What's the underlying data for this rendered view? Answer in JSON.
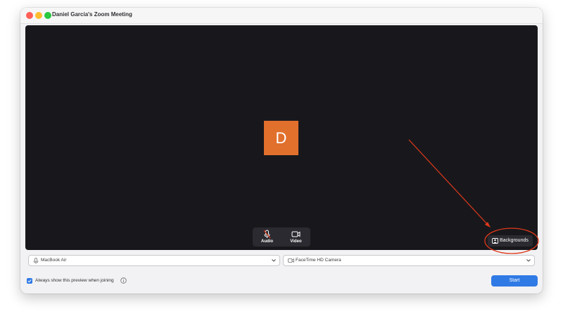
{
  "window": {
    "title": "Daniel Garcia's Zoom Meeting"
  },
  "preview": {
    "avatar_initial": "D",
    "avatar_color": "#e1702d"
  },
  "controls": {
    "audio_label": "Audio",
    "video_label": "Video"
  },
  "backgrounds": {
    "label": "Backgrounds"
  },
  "devices": {
    "microphone": "MacBook Air",
    "camera": "FaceTime HD Camera"
  },
  "footer": {
    "always_show_label": "Always show this preview when joining",
    "always_show_checked": true,
    "start_label": "Start"
  },
  "colors": {
    "accent": "#2f7ae5",
    "annotation": "#e0391b"
  }
}
